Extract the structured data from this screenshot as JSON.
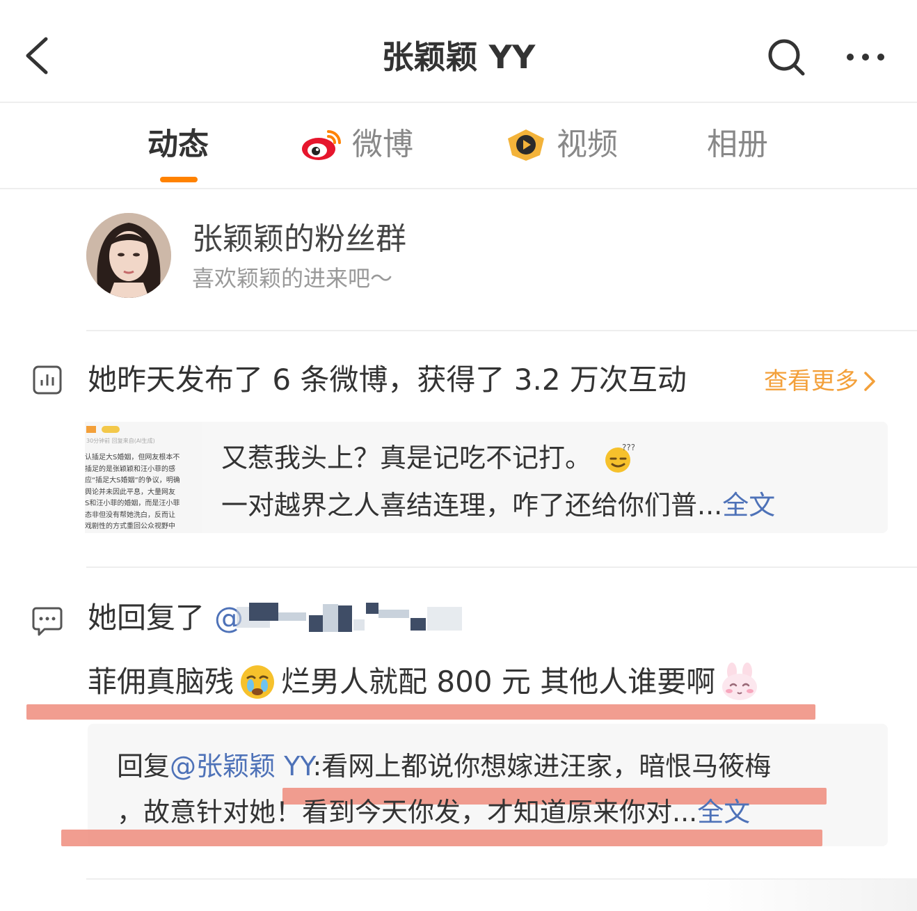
{
  "header": {
    "title": "张颖颖 YY",
    "back_icon": "chevron-left-icon",
    "search_icon": "search-icon",
    "more_icon": "more-horizontal-icon"
  },
  "tabs": [
    {
      "label": "动态",
      "active": true
    },
    {
      "label": "微博",
      "icon": "weibo-logo-icon"
    },
    {
      "label": "视频",
      "icon": "video-play-icon"
    },
    {
      "label": "相册"
    }
  ],
  "fan_group": {
    "name": "张颖颖的粉丝群",
    "desc": "喜欢颖颖的进来吧～"
  },
  "stats": {
    "text": "她昨天发布了 6 条微博，获得了 3.2 万次互动",
    "more": "查看更多"
  },
  "post": {
    "thumb_lines": [
      "认插足大S婚姻，但网友根本不",
      "插足的是张颖颖和汪小菲的感",
      "应“插足大S婚姻”的争议，明确",
      "舆论并未因此平息，大量网友",
      "S和汪小菲的婚姻，而是汪小菲",
      "态非但没有帮她洗白，反而让",
      "戏剧性的方式重回公众视野中"
    ],
    "thumb_meta": "30分钟前 回复来自(AI生成)",
    "line1": "又惹我头上？真是记吃不记打。",
    "line2": "一对越界之人喜结连理，咋了还给你们普...",
    "full": "全文"
  },
  "reply": {
    "prefix": "她回复了",
    "at": "@",
    "content": "菲佣真脑残",
    "content2": "烂男人就配 800 元 其他人谁要啊",
    "quote_prefix": "回复",
    "quote_at": "@张颖颖 YY",
    "quote_text1": ":看网上都说你想嫁进汪家，暗恨马筱梅",
    "quote_text2": "，故意针对她！看到今天你发，才知道原来你对...",
    "full": "全文"
  },
  "colors": {
    "accent": "#ff8200",
    "link": "#4e72b8",
    "more": "#f3a03a",
    "highlight": "#ef8c7c"
  }
}
